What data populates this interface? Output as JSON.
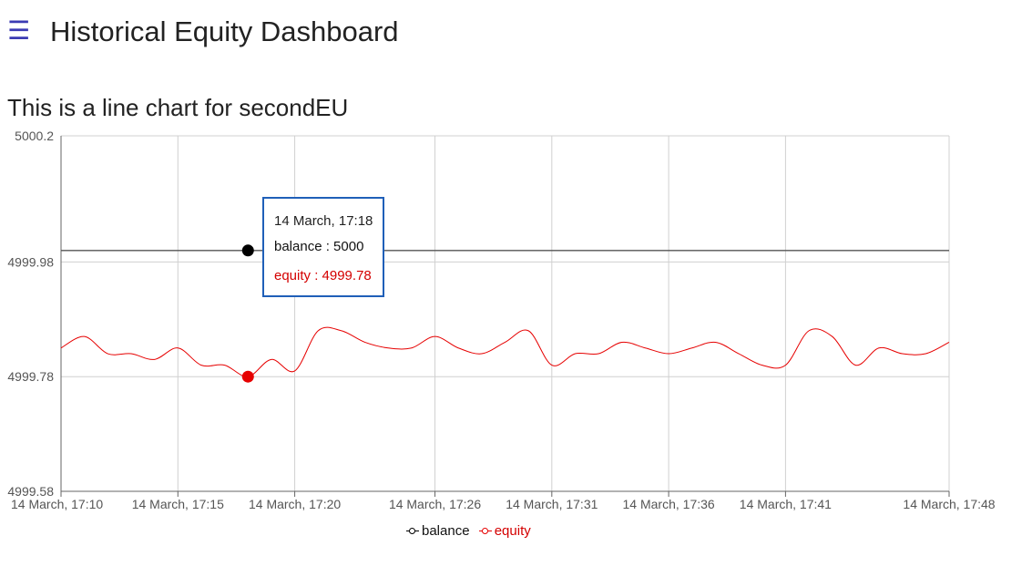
{
  "header": {
    "menu_icon": "hamburger-menu-icon",
    "title": "Historical Equity Dashboard"
  },
  "subtitle": "This is a line chart for secondEU",
  "tooltip": {
    "time": "14 March, 17:18",
    "balance": "balance : 5000",
    "equity": "equity : 4999.78"
  },
  "colors": {
    "balance": "#000000",
    "equity": "#e60000",
    "tooltip_border": "#1f5fb8",
    "menu_icon": "#3b3bb3"
  },
  "chart_data": {
    "type": "line",
    "title": "",
    "xlabel": "",
    "ylabel": "",
    "ylim": [
      4999.58,
      5000.2
    ],
    "yticks": [
      "5000.2",
      "4999.98",
      "4999.78",
      "4999.58"
    ],
    "ytick_values": [
      5000.2,
      4999.98,
      4999.78,
      4999.58
    ],
    "xlim": [
      "14 March, 17:10",
      "14 March, 17:48"
    ],
    "xticks": [
      "14 March, 17:10",
      "14 March, 17:15",
      "14 March, 17:20",
      "14 March, 17:26",
      "14 March, 17:31",
      "14 March, 17:36",
      "14 March, 17:41",
      "14 March, 17:48"
    ],
    "xtick_values": [
      "2024-03-14T17:10",
      "2024-03-14T17:15",
      "2024-03-14T17:20",
      "2024-03-14T17:26",
      "2024-03-14T17:31",
      "2024-03-14T17:36",
      "2024-03-14T17:41",
      "2024-03-14T17:48"
    ],
    "grid": true,
    "legend": "bottom-center",
    "series": [
      {
        "name": "balance",
        "x": [
          "2024-03-14T17:10",
          "2024-03-14T17:48"
        ],
        "values": [
          5000.0,
          5000.0
        ]
      },
      {
        "name": "equity",
        "x": [
          "2024-03-14T17:10",
          "2024-03-14T17:11",
          "2024-03-14T17:12",
          "2024-03-14T17:13",
          "2024-03-14T17:14",
          "2024-03-14T17:15",
          "2024-03-14T17:16",
          "2024-03-14T17:17",
          "2024-03-14T17:18",
          "2024-03-14T17:19",
          "2024-03-14T17:20",
          "2024-03-14T17:21",
          "2024-03-14T17:22",
          "2024-03-14T17:23",
          "2024-03-14T17:24",
          "2024-03-14T17:25",
          "2024-03-14T17:26",
          "2024-03-14T17:27",
          "2024-03-14T17:28",
          "2024-03-14T17:29",
          "2024-03-14T17:30",
          "2024-03-14T17:31",
          "2024-03-14T17:32",
          "2024-03-14T17:33",
          "2024-03-14T17:34",
          "2024-03-14T17:35",
          "2024-03-14T17:36",
          "2024-03-14T17:37",
          "2024-03-14T17:38",
          "2024-03-14T17:39",
          "2024-03-14T17:40",
          "2024-03-14T17:41",
          "2024-03-14T17:42",
          "2024-03-14T17:43",
          "2024-03-14T17:44",
          "2024-03-14T17:45",
          "2024-03-14T17:46",
          "2024-03-14T17:47",
          "2024-03-14T17:48"
        ],
        "values": [
          4999.83,
          4999.85,
          4999.82,
          4999.82,
          4999.81,
          4999.83,
          4999.8,
          4999.8,
          4999.78,
          4999.81,
          4999.79,
          4999.86,
          4999.86,
          4999.84,
          4999.83,
          4999.83,
          4999.85,
          4999.83,
          4999.82,
          4999.84,
          4999.86,
          4999.8,
          4999.82,
          4999.82,
          4999.84,
          4999.83,
          4999.82,
          4999.83,
          4999.84,
          4999.82,
          4999.8,
          4999.8,
          4999.86,
          4999.85,
          4999.8,
          4999.83,
          4999.82,
          4999.82,
          4999.84
        ]
      }
    ],
    "highlight": {
      "x": "2024-03-14T17:18",
      "balance": 5000,
      "equity": 4999.78
    }
  }
}
